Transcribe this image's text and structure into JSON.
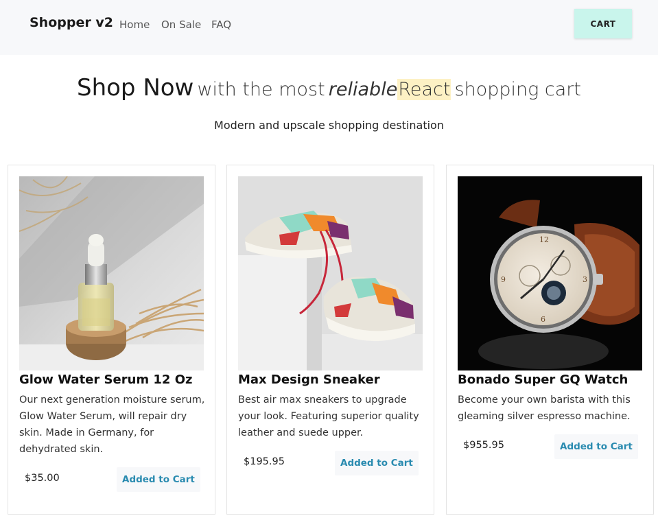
{
  "navbar": {
    "brand": "Shopper v2",
    "links": [
      "Home",
      "On Sale",
      "FAQ"
    ],
    "cart_label": "CART",
    "colors": {
      "background": "#f7f8fa",
      "cart_button": "#c9f5ec"
    }
  },
  "hero": {
    "shop_now": "Shop Now",
    "with_the_most": "with the most",
    "reliable": "reliable",
    "react": "React",
    "shopping_cart": "shopping cart",
    "subtitle": "Modern and upscale shopping destination",
    "highlight_color": "#fdf1c4"
  },
  "products": [
    {
      "title": "Glow Water Serum 12 Oz",
      "description": "Our next generation moisture serum, Glow Water Serum, will repair dry skin. Made in Germany, for dehydrated skin.",
      "price": "$35.00",
      "button_label": "Added to Cart",
      "image": "serum-bottle-image"
    },
    {
      "title": "Max Design Sneaker",
      "description": "Best air max sneakers to upgrade your look. Featuring superior quality leather and suede upper.",
      "price": "$195.95",
      "button_label": "Added to Cart",
      "image": "sneaker-image"
    },
    {
      "title": "Bonado Super GQ Watch",
      "description": "Become your own barista with this gleaming silver espresso machine.",
      "price": "$955.95",
      "button_label": "Added to Cart",
      "image": "watch-image"
    }
  ],
  "accent_color": "#2a8bb0"
}
